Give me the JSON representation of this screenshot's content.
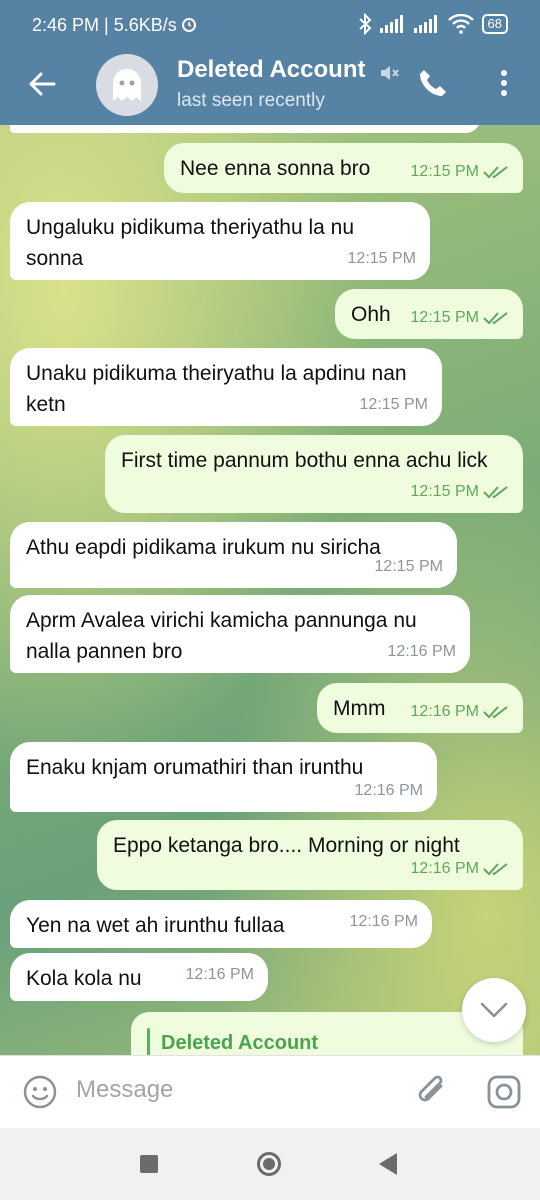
{
  "status_bar": {
    "time": "2:46 PM | 5.6KB/s",
    "battery": "68"
  },
  "header": {
    "title": "Deleted Account",
    "subtitle": "last seen recently"
  },
  "messages": [
    {
      "dir": "out",
      "text": "Nee enna sonna bro",
      "time": "12:15 PM"
    },
    {
      "dir": "in",
      "text": "Ungaluku pidikuma theriyathu la nu sonna",
      "time": "12:15 PM"
    },
    {
      "dir": "out",
      "text": "Ohh",
      "time": "12:15 PM"
    },
    {
      "dir": "in",
      "text": "Unaku pidikuma theiryathu la apdinu nan ketn",
      "time": "12:15 PM"
    },
    {
      "dir": "out",
      "text": "First time pannum bothu enna achu lick",
      "time": "12:15 PM"
    },
    {
      "dir": "in",
      "text": "Athu eapdi pidikama irukum nu siricha",
      "time": "12:15 PM"
    },
    {
      "dir": "in",
      "text": "Aprm Avalea virichi kamicha pannunga nu nalla pannen bro",
      "time": "12:16 PM"
    },
    {
      "dir": "out",
      "text": "Mmm",
      "time": "12:16 PM"
    },
    {
      "dir": "in",
      "text": "Enaku knjam orumathiri than irunthu",
      "time": "12:16 PM"
    },
    {
      "dir": "out",
      "text": "Eppo ketanga bro.... Morning or night",
      "time": "12:16 PM"
    },
    {
      "dir": "in",
      "text": "Yen na wet ah irunthu fullaa",
      "time": "12:16 PM"
    },
    {
      "dir": "in",
      "text": "Kola kola nu",
      "time": "12:16 PM"
    }
  ],
  "reply_preview": {
    "name": "Deleted Account"
  },
  "composer": {
    "placeholder": "Message"
  },
  "colors": {
    "header": "#5682a3",
    "outgoing_bubble": "#effdde",
    "incoming_bubble": "#ffffff",
    "read_ticks": "#60a75d"
  }
}
